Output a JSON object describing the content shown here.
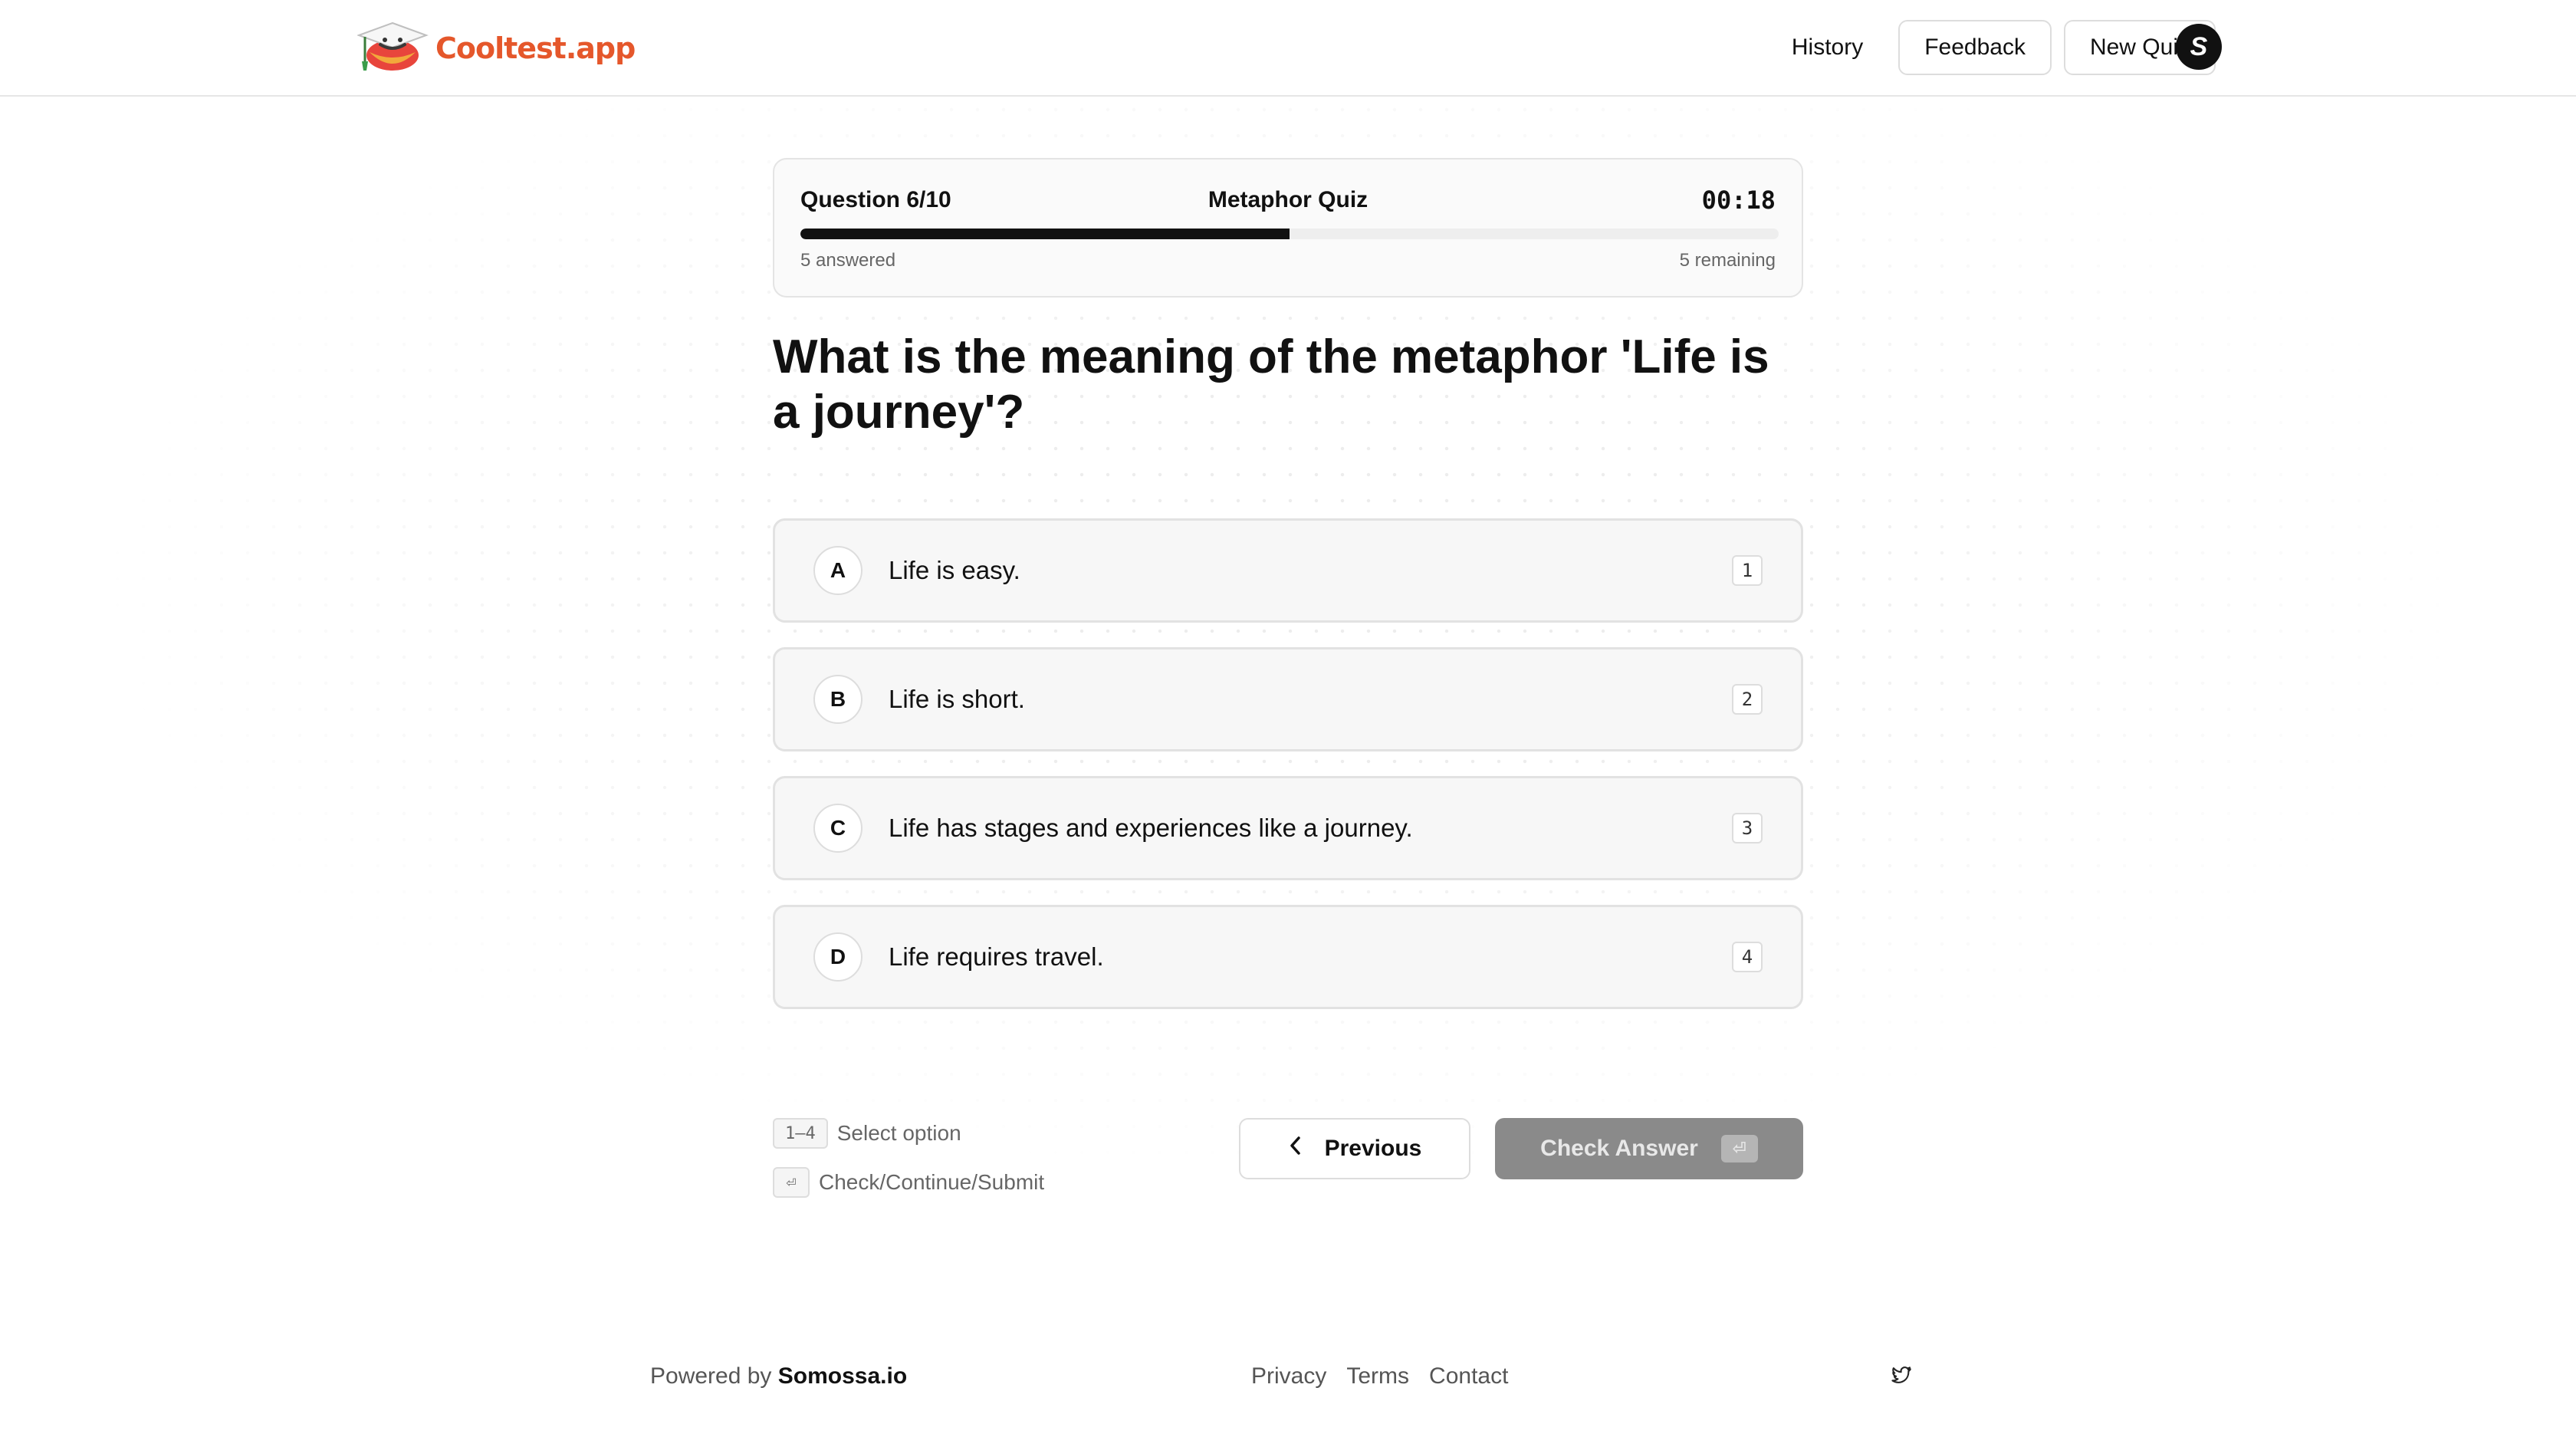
{
  "header": {
    "logo_text": "Cooltest.app",
    "nav": {
      "history": "History",
      "feedback": "Feedback",
      "new_quiz": "New Quiz"
    },
    "avatar_letter": "S"
  },
  "progress": {
    "question_label": "Question 6/10",
    "quiz_title": "Metaphor Quiz",
    "timer": "00:18",
    "answered": "5 answered",
    "remaining": "5 remaining",
    "fraction": 0.5
  },
  "question": {
    "text": "What is the meaning of the metaphor 'Life is a journey'?"
  },
  "options": [
    {
      "letter": "A",
      "text": "Life is easy.",
      "key": "1"
    },
    {
      "letter": "B",
      "text": "Life is short.",
      "key": "2"
    },
    {
      "letter": "C",
      "text": "Life has stages and experiences like a journey.",
      "key": "3"
    },
    {
      "letter": "D",
      "text": "Life requires travel.",
      "key": "4"
    }
  ],
  "hints": {
    "select_key": "1–4",
    "select_label": "Select option",
    "check_key": "⏎",
    "check_label": "Check/Continue/Submit"
  },
  "buttons": {
    "previous": "Previous",
    "check_answer": "Check Answer",
    "check_key": "⏎"
  },
  "footer": {
    "powered_by": "Powered by",
    "brand": "Somossa.io",
    "links": {
      "privacy": "Privacy",
      "terms": "Terms",
      "contact": "Contact"
    }
  },
  "icons": {
    "logo": "graduation-cap-icon",
    "previous": "chevron-left-icon",
    "social": "twitter-icon"
  },
  "colors": {
    "brand": "#e5572b",
    "progress_fill": "#111111",
    "check_button_disabled": "#8a8a8a"
  }
}
